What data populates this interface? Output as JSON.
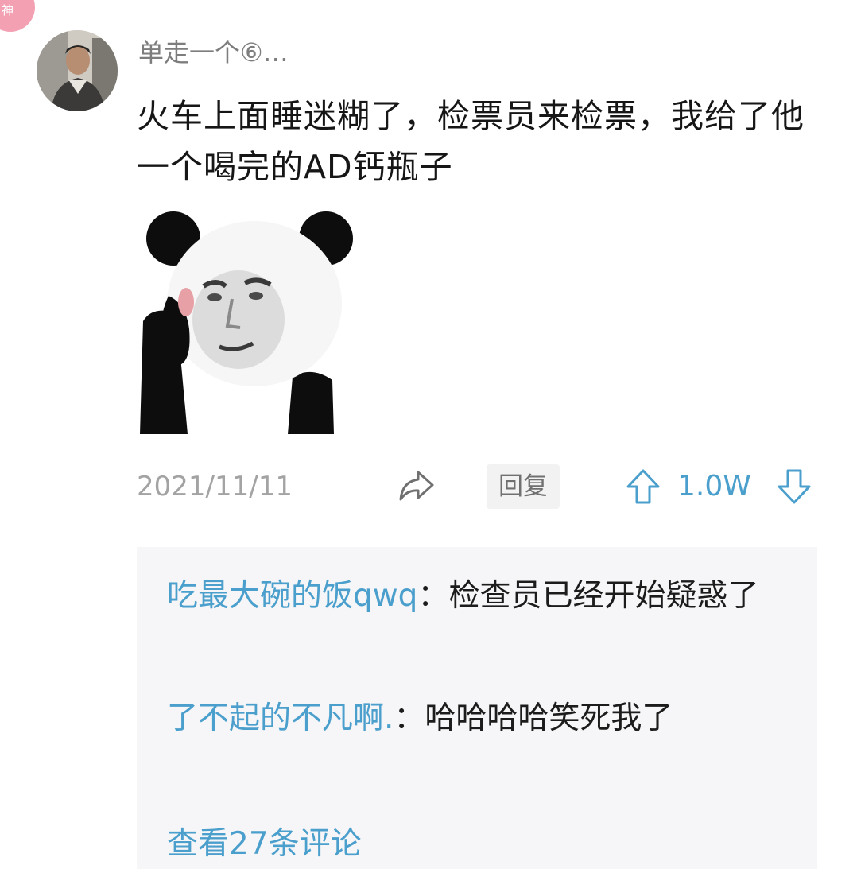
{
  "badge": {
    "label": "神"
  },
  "post": {
    "username": "单走一个⑥…",
    "text": "火车上面睡迷糊了，检票员来检票，我给了他一个喝完的AD钙瓶子",
    "image": "panda-meme-sticker",
    "date": "2021/11/11",
    "reply_label": "回复",
    "likes": "1.0W"
  },
  "replies": [
    {
      "name": "吃最大碗的饭qwq",
      "separator": "：",
      "text": "检查员已经开始疑惑了"
    },
    {
      "name": "了不起的不凡啊.",
      "separator": "：",
      "text": "哈哈哈哈笑死我了"
    }
  ],
  "more_comments": "查看27条评论",
  "colors": {
    "link": "#4b9fcc",
    "muted": "#a3a3a3",
    "badge": "#f3a0b3",
    "reply_bg": "#f6f6f8"
  }
}
